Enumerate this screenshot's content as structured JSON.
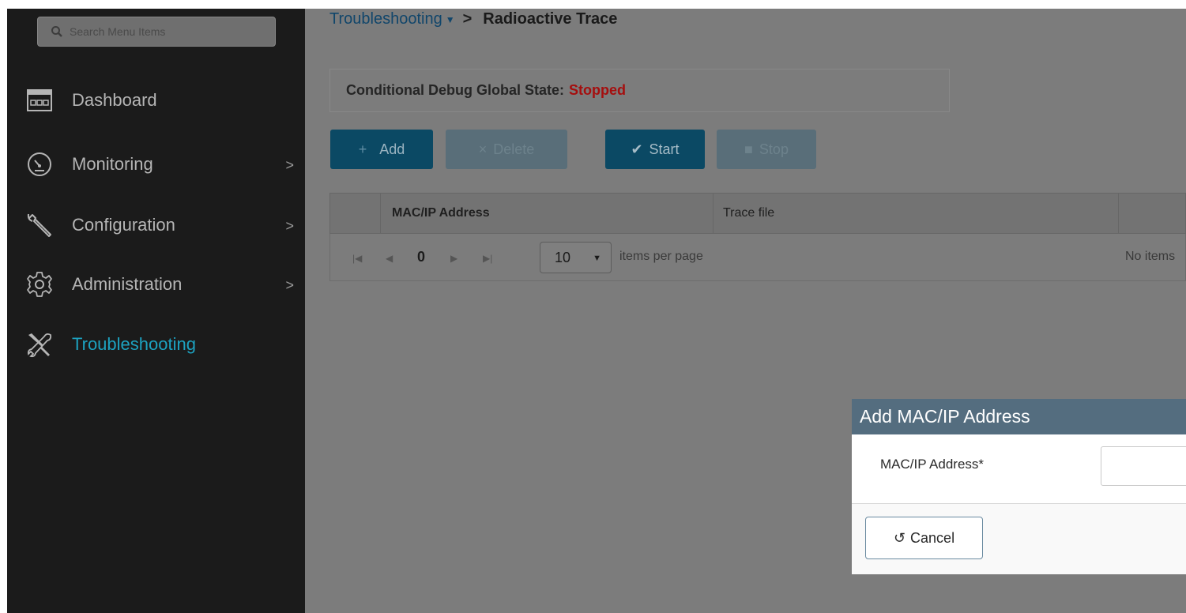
{
  "sidebar": {
    "search_placeholder": "Search Menu Items",
    "items": [
      {
        "label": "Dashboard",
        "icon": "dashboard-icon",
        "has_submenu": false,
        "active": false
      },
      {
        "label": "Monitoring",
        "icon": "gauge-icon",
        "has_submenu": true,
        "active": false
      },
      {
        "label": "Configuration",
        "icon": "wrench-icon",
        "has_submenu": true,
        "active": false
      },
      {
        "label": "Administration",
        "icon": "gear-icon",
        "has_submenu": true,
        "active": false
      },
      {
        "label": "Troubleshooting",
        "icon": "tools-icon",
        "has_submenu": false,
        "active": true
      }
    ],
    "chevron": ">"
  },
  "breadcrumb": {
    "parent": "Troubleshooting",
    "separator": ">",
    "current": "Radioactive Trace"
  },
  "debug_state": {
    "label": "Conditional Debug Global State:",
    "value": "Stopped"
  },
  "toolbar": {
    "add_label": "Add",
    "delete_label": "Delete",
    "start_label": "Start",
    "stop_label": "Stop"
  },
  "table": {
    "columns": [
      "MAC/IP Address",
      "Trace file"
    ],
    "page_number": "0",
    "items_per_page": "10",
    "items_per_page_label": "items per page",
    "empty_text": "No items"
  },
  "modal": {
    "title": "Add MAC/IP Address",
    "field_label": "MAC/IP Address*",
    "field_value": "",
    "cancel_label": "Cancel"
  },
  "colors": {
    "sidebar_bg": "#1b1b1b",
    "active_accent": "#1da2c0",
    "stopped": "#a50e0e",
    "primary_button": "#0b4964",
    "modal_header": "#546d7f"
  }
}
